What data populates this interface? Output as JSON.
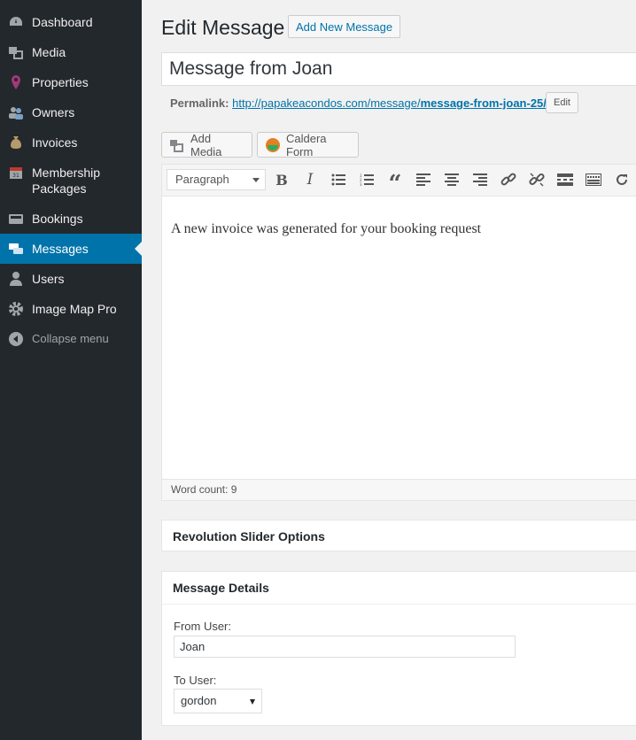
{
  "sidebar": {
    "items": [
      {
        "label": "Dashboard",
        "icon": "dashboard-icon"
      },
      {
        "label": "Media",
        "icon": "media-icon"
      },
      {
        "label": "Properties",
        "icon": "map-pin-icon"
      },
      {
        "label": "Owners",
        "icon": "owners-icon"
      },
      {
        "label": "Invoices",
        "icon": "money-bag-icon"
      },
      {
        "label": "Membership Packages",
        "icon": "calendar-icon"
      },
      {
        "label": "Bookings",
        "icon": "bookings-icon"
      },
      {
        "label": "Messages",
        "icon": "messages-icon",
        "active": true
      },
      {
        "label": "Users",
        "icon": "user-icon"
      },
      {
        "label": "Image Map Pro",
        "icon": "gear-icon"
      }
    ],
    "collapse_label": "Collapse menu",
    "active_color": "#0073aa",
    "background": "#23282d"
  },
  "header": {
    "title": "Edit Message",
    "add_new_label": "Add New Message"
  },
  "post": {
    "title": "Message from Joan",
    "permalink_label": "Permalink:",
    "permalink_base": "http://papakeacondos.com/message/",
    "permalink_slug": "message-from-joan-25/",
    "permalink_edit_label": "Edit"
  },
  "media_buttons": {
    "add_media_label": "Add Media",
    "caldera_label": "Caldera Form"
  },
  "editor": {
    "format_value": "Paragraph",
    "toolbar_icons": [
      "bold-icon",
      "italic-icon",
      "bullet-list-icon",
      "numbered-list-icon",
      "blockquote-icon",
      "align-left-icon",
      "align-center-icon",
      "align-right-icon",
      "link-icon",
      "unlink-icon",
      "read-more-icon",
      "toolbar-toggle-icon",
      "refresh-icon"
    ],
    "content": "A new invoice was generated for your booking request",
    "word_count": "Word count: 9"
  },
  "revolution_box": {
    "title": "Revolution Slider Options"
  },
  "details_box": {
    "title": "Message Details",
    "from_label": "From User:",
    "from_value": "Joan",
    "to_label": "To User:",
    "to_value": "gordon"
  }
}
